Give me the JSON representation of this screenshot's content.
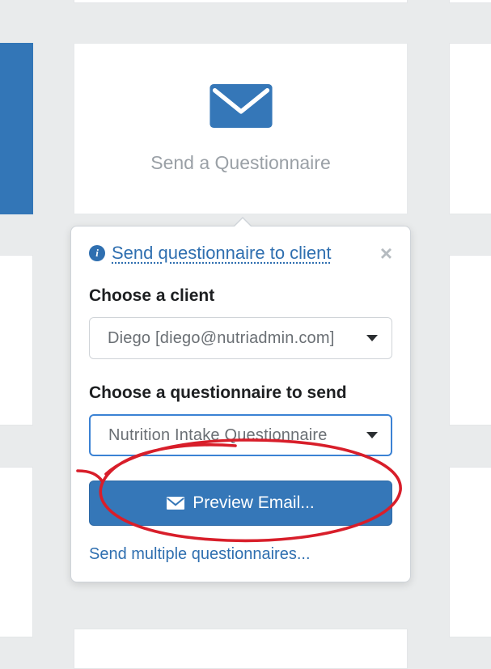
{
  "card": {
    "title": "Send a Questionnaire"
  },
  "popover": {
    "title": "Send questionnaire to client",
    "close_glyph": "×",
    "client_label": "Choose a client",
    "client_selected": "Diego [diego@nutriadmin.com]",
    "questionnaire_label": "Choose a questionnaire to send",
    "questionnaire_selected": "Nutrition Intake Questionnaire",
    "preview_label": "Preview Email...",
    "multi_link_label": "Send multiple questionnaires...",
    "info_glyph": "i"
  }
}
